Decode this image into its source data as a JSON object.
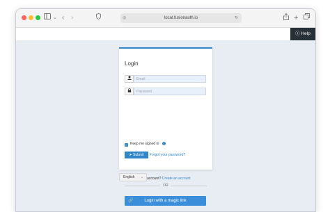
{
  "browser": {
    "url": "local.fusionauth.io",
    "icons": {
      "sidebar": "sidebar-icon",
      "back": "chevron-left-icon",
      "forward": "chevron-right-icon",
      "shield": "shield-icon",
      "share": "share-icon",
      "new_tab": "plus-icon",
      "tabs": "tabs-overview-icon",
      "reload": "reload-icon"
    },
    "dots": {
      "close": "#ff5f57",
      "minimize": "#febc2e",
      "maximize": "#28c840"
    }
  },
  "help": {
    "label": "Help",
    "icon": "help-circle-icon"
  },
  "login": {
    "title": "Login",
    "email_placeholder": "Email",
    "password_placeholder": "Password",
    "keep_signed_in": "Keep me signed in",
    "submit_label": "Submit",
    "forgot_password": "Forgot your password?",
    "no_account": "Don't have an account?",
    "create_account": "Create an account",
    "or": "OR",
    "magic_link": "Login with a magic link"
  },
  "language": {
    "selected": "English"
  },
  "colors": {
    "accent": "#2f86c8",
    "help_bg": "#263238",
    "page_bg": "#e8edf4"
  }
}
